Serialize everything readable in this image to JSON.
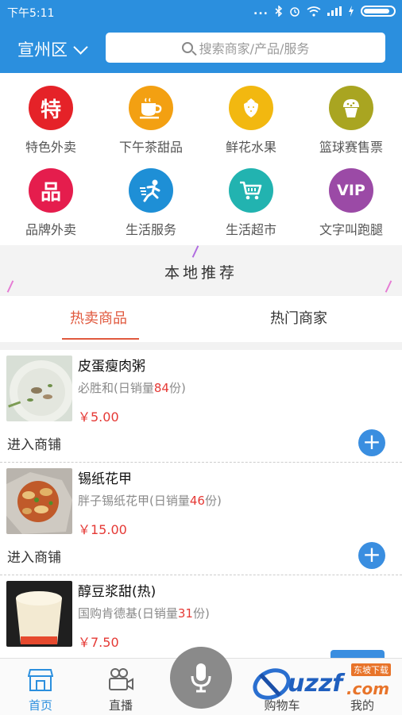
{
  "status_bar": {
    "time": "下午5:11",
    "dots": "..."
  },
  "header": {
    "city": "宣州区",
    "search_placeholder": "搜索商家/产品/服务"
  },
  "categories": [
    {
      "label": "特色外卖",
      "icon": "te-char-icon",
      "glyph": "特",
      "color": "#e52228"
    },
    {
      "label": "下午茶甜品",
      "icon": "coffee-cup-icon",
      "glyph": "",
      "color": "#f3a012"
    },
    {
      "label": "鲜花水果",
      "icon": "strawberry-icon",
      "glyph": "",
      "color": "#f2b810"
    },
    {
      "label": "篮球赛售票",
      "icon": "cupcake-icon",
      "glyph": "",
      "color": "#a9a521"
    },
    {
      "label": "品牌外卖",
      "icon": "brand-box-icon",
      "glyph": "品",
      "color": "#e51d4d"
    },
    {
      "label": "生活服务",
      "icon": "running-person-icon",
      "glyph": "",
      "color": "#1e8fd6"
    },
    {
      "label": "生活超市",
      "icon": "shopping-cart-icon",
      "glyph": "",
      "color": "#22b3b0"
    },
    {
      "label": "文字叫跑腿",
      "icon": "vip-crown-icon",
      "glyph": "VIP",
      "color": "#9b4aa6"
    }
  ],
  "recommend_title": "本地推荐",
  "tabs": {
    "hot_goods": "热卖商品",
    "hot_shops": "热门商家"
  },
  "products": [
    {
      "name": "皮蛋瘦肉粥",
      "shop": "必胜和",
      "sales_prefix": "(日销量",
      "sales": "84",
      "sales_suffix": "份)",
      "price": "￥5.00",
      "enter": "进入商铺",
      "plus": "+"
    },
    {
      "name": "锡纸花甲",
      "shop": "胖子锡纸花甲",
      "sales_prefix": "(日销量",
      "sales": "46",
      "sales_suffix": "份)",
      "price": "￥15.00",
      "enter": "进入商铺",
      "plus": "+"
    },
    {
      "name": "醇豆浆甜(热)",
      "shop": "国购肯德基",
      "sales_prefix": "(日销量",
      "sales": "31",
      "sales_suffix": "份)",
      "price": "￥7.50",
      "enter": "",
      "plus": ""
    }
  ],
  "bottom_nav": {
    "home": "首页",
    "live": "直播",
    "cart": "购物车",
    "mine": "我的"
  },
  "watermark": {
    "brand": "uzzf",
    "domain": ".com",
    "tagline": "东坡下载"
  },
  "colors": {
    "primary": "#2b8fde",
    "accent_red": "#e53935",
    "tab_active": "#e0593e"
  }
}
